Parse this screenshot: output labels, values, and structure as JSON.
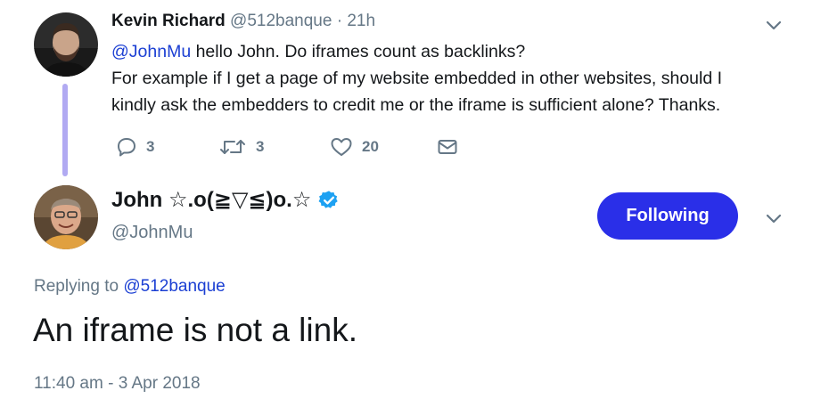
{
  "tweet1": {
    "author_name": "Kevin Richard",
    "author_handle": "@512banque",
    "separator": "·",
    "time": "21h",
    "mention": "@JohnMu",
    "text_line1_rest": " hello John. Do iframes count as backlinks?",
    "text_line2": "For example if I get a page of my website embedded in other websites, should I",
    "text_line3": "kindly ask the embedders to credit me or the iframe is sufficient alone? Thanks.",
    "actions": {
      "reply_count": "3",
      "retweet_count": "3",
      "like_count": "20"
    },
    "icons": [
      "reply-icon",
      "retweet-icon",
      "like-icon",
      "message-icon",
      "chevron-down-icon"
    ]
  },
  "tweet2": {
    "author_name": "John ☆.o(≧▽≦)o.☆",
    "author_handle": "@JohnMu",
    "follow_label": "Following",
    "replying_prefix": "Replying to ",
    "replying_to": "@512banque",
    "text": "An iframe is not a link.",
    "timestamp": "11:40 am - 3 Apr 2018",
    "icons": [
      "verified-badge-icon",
      "chevron-down-icon"
    ]
  },
  "colors": {
    "link": "#1b3fd3",
    "follow_button": "#2a2fe8",
    "muted_text": "#657786",
    "thread_line": "#b1aaf2",
    "verified": "#1da1f2"
  }
}
